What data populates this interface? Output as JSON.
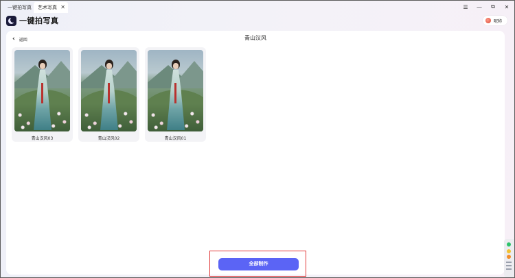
{
  "tabs": [
    {
      "label": "一键拍写真",
      "active": false
    },
    {
      "label": "艺术写真",
      "active": true,
      "close": "✕"
    }
  ],
  "window_controls": {
    "menu": "☰",
    "minimize": "—",
    "restore": "⧉",
    "close": "✕"
  },
  "header": {
    "title": "一键拍写真"
  },
  "user": {
    "name": "昵称"
  },
  "panel": {
    "back_label": "返回",
    "back_icon": "‹",
    "title": "青山汉风"
  },
  "cards": [
    {
      "label": "青山汉风03"
    },
    {
      "label": "青山汉风02"
    },
    {
      "label": "青山汉风01"
    }
  ],
  "action": {
    "label": "全部制作",
    "color": "#5b64f5"
  }
}
